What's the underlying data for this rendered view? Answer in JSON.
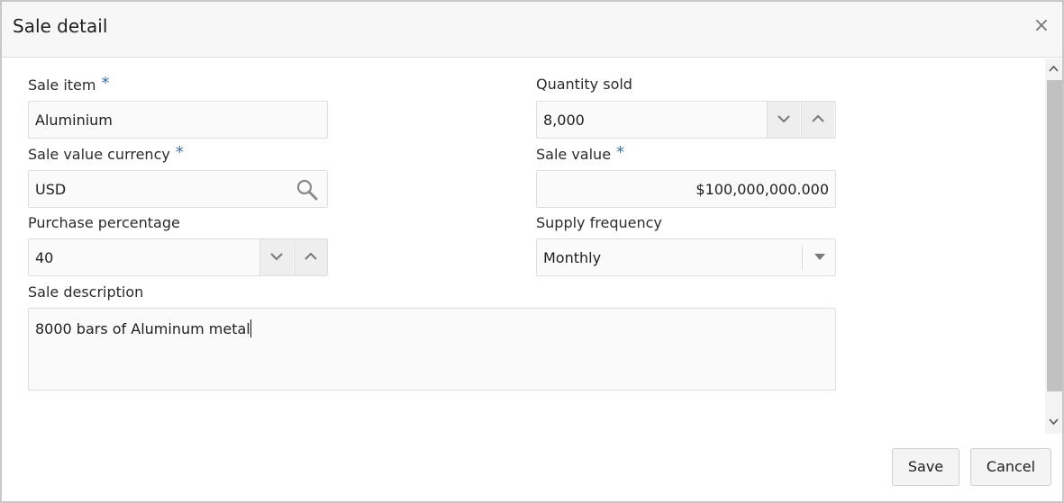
{
  "dialog": {
    "title": "Sale detail",
    "close_label": "×"
  },
  "form": {
    "sale_item": {
      "label": "Sale item",
      "required": "*",
      "value": "Aluminium"
    },
    "quantity_sold": {
      "label": "Quantity sold",
      "value": "8,000"
    },
    "sale_value_currency": {
      "label": "Sale value currency",
      "required": "*",
      "value": "USD"
    },
    "sale_value": {
      "label": "Sale value",
      "required": "*",
      "value": "$100,000,000.000"
    },
    "purchase_percentage": {
      "label": "Purchase percentage",
      "value": "40"
    },
    "supply_frequency": {
      "label": "Supply frequency",
      "value": "Monthly"
    },
    "sale_description": {
      "label": "Sale description",
      "value": "8000 bars of Aluminum metal"
    }
  },
  "footer": {
    "save_label": "Save",
    "cancel_label": "Cancel"
  },
  "icons": {
    "search": "search-icon",
    "spin_down": "chevron-down-icon",
    "spin_up": "chevron-up-icon",
    "dropdown": "caret-down-icon",
    "close": "close-icon"
  },
  "colors": {
    "required_marker": "#3b6fa0",
    "header_bg": "#f7f7f7",
    "field_bg": "#fbfafa"
  }
}
